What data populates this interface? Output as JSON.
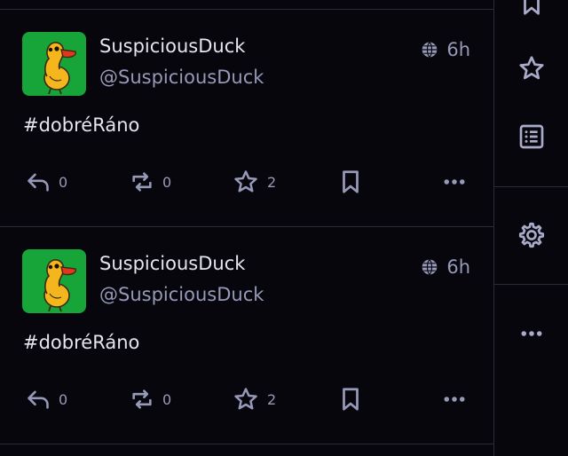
{
  "colors": {
    "background": "#06060c",
    "divider": "#2a2c3a",
    "muted_text": "#9799b8",
    "primary_text": "#e4e5ee",
    "avatar_bg": "#17a53a",
    "duck_body": "#f5b51c",
    "duck_beak": "#e2361f"
  },
  "posts": [
    {
      "display_name": "SuspiciousDuck",
      "handle": "@SuspiciousDuck",
      "time": "6h",
      "visibility_icon": "globe-icon",
      "content": "#dobréRáno",
      "replies": "0",
      "boosts": "0",
      "favourites": "2"
    },
    {
      "display_name": "SuspiciousDuck",
      "handle": "@SuspiciousDuck",
      "time": "6h",
      "visibility_icon": "globe-icon",
      "content": "#dobréRáno",
      "replies": "0",
      "boosts": "0",
      "favourites": "2"
    }
  ],
  "sidebar": {
    "icons": [
      "bookmarks-icon",
      "star-icon",
      "lists-icon",
      "gear-icon",
      "more-icon"
    ]
  }
}
